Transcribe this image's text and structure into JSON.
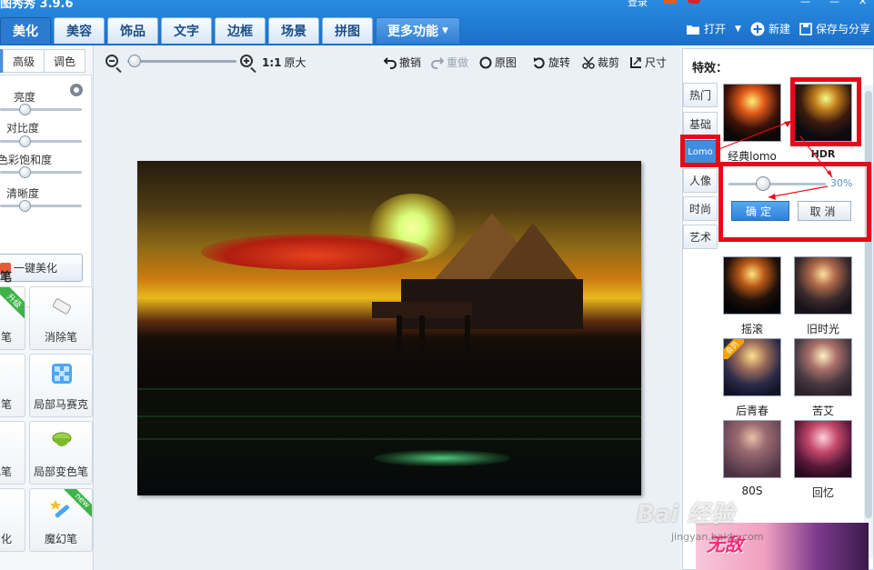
{
  "app": {
    "title": "图秀秀 3.9.6",
    "top_right_mini": "登录"
  },
  "tabs": [
    "美化",
    "美容",
    "饰品",
    "文字",
    "边框",
    "场景",
    "拼图",
    "更多功能"
  ],
  "top_actions": {
    "open": "打开",
    "new": "新建",
    "save_share": "保存与分享"
  },
  "left_panel": {
    "sub_tabs": [
      "高级",
      "调色"
    ],
    "sliders": [
      {
        "label": "亮度",
        "value": 0.3
      },
      {
        "label": "对比度",
        "value": 0.3
      },
      {
        "label": "色彩饱和度",
        "value": 0.3
      },
      {
        "label": "清晰度",
        "value": 0.3
      }
    ],
    "one_click": "一键美化",
    "brush_title": "笔",
    "tools": [
      {
        "label": "笔",
        "badge": "升级"
      },
      {
        "label": "消除笔"
      },
      {
        "label": "笔"
      },
      {
        "label": "局部马赛克"
      },
      {
        "label": "色笔"
      },
      {
        "label": "局部变色笔"
      },
      {
        "label": "化"
      },
      {
        "label": "魔幻笔",
        "badge": "new"
      }
    ]
  },
  "toolbar": {
    "ratio": "1:1",
    "original_size": "原大",
    "undo": "撤销",
    "redo": "重做",
    "original": "原图",
    "rotate": "旋转",
    "crop": "裁剪",
    "size": "尺寸",
    "zoom_level": 0.05
  },
  "right_panel": {
    "title": "特效：",
    "categories": [
      "热门",
      "基础",
      "Lomo",
      "人像",
      "时尚",
      "艺术"
    ],
    "active_category": "Lomo",
    "effects_top": [
      {
        "name": "经典lomo"
      },
      {
        "name": "HDR"
      }
    ],
    "strength": {
      "value_text": "30%",
      "value": 0.3
    },
    "confirm": "确定",
    "cancel": "取消",
    "effects_grid": [
      {
        "name": "摇滚"
      },
      {
        "name": "旧时光"
      },
      {
        "name": "后青春",
        "badge": "会员"
      },
      {
        "name": "苦艾"
      },
      {
        "name": "80S"
      },
      {
        "name": "回忆"
      }
    ]
  },
  "ad": {
    "text": "无敌"
  },
  "watermark": {
    "text": "Bai 经验",
    "sub": "jingyan.baidu.com"
  },
  "colors": {
    "highlight_red": "#e8081a",
    "brand_blue": "#1a6fc8",
    "active_tab": "#3e8de0"
  }
}
